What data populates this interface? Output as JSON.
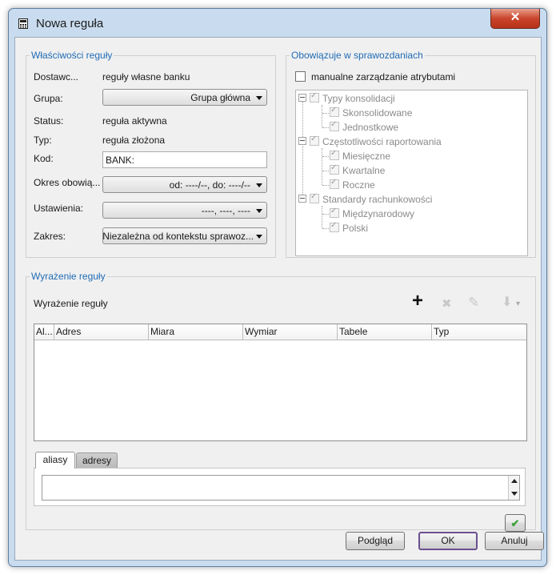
{
  "window": {
    "title": "Nowa reguła",
    "close_symbol": "✕"
  },
  "properties": {
    "legend": "Właściwości reguły",
    "provider_label": "Dostawc...",
    "provider_value": "reguły własne banku",
    "group_label": "Grupa:",
    "group_value": "Grupa główna",
    "status_label": "Status:",
    "status_value": "reguła aktywna",
    "type_label": "Typ:",
    "type_value": "reguła złożona",
    "code_label": "Kod:",
    "code_value": "BANK:",
    "period_label": "Okres obowią...",
    "period_value": "od: ----/--, do: ----/--",
    "settings_label": "Ustawienia:",
    "settings_value": "----, ----, ----",
    "scope_label": "Zakres:",
    "scope_value": "Niezależna od kontekstu sprawoz..."
  },
  "reports": {
    "legend": "Obowiązuje w sprawozdaniach",
    "manual_label": "manualne zarządzanie atrybutami",
    "tree": [
      {
        "label": "Typy konsolidacji",
        "children": [
          "Skonsolidowane",
          "Jednostkowe"
        ]
      },
      {
        "label": "Częstotliwości raportowania",
        "children": [
          "Miesięczne",
          "Kwartalne",
          "Roczne"
        ]
      },
      {
        "label": "Standardy rachunkowości",
        "children": [
          "Międzynarodowy",
          "Polski"
        ]
      }
    ]
  },
  "expression": {
    "legend": "Wyrażenie reguły",
    "title": "Wyrażenie reguły",
    "columns": [
      "Al...",
      "Adres",
      "Miara",
      "Wymiar",
      "Tabele",
      "Typ"
    ],
    "tabs": [
      "aliasy",
      "adresy"
    ],
    "toolbar": {
      "add": "+",
      "delete": "✖",
      "edit": "✎",
      "move": "⬇",
      "more": "▾"
    },
    "confirm_symbol": "✔"
  },
  "buttons": {
    "preview": "Podgląd",
    "ok": "OK",
    "cancel": "Anuluj"
  },
  "colors": {
    "legend": "#1f6bb5",
    "close": "#c9442b",
    "confirm": "#3fa23f"
  }
}
